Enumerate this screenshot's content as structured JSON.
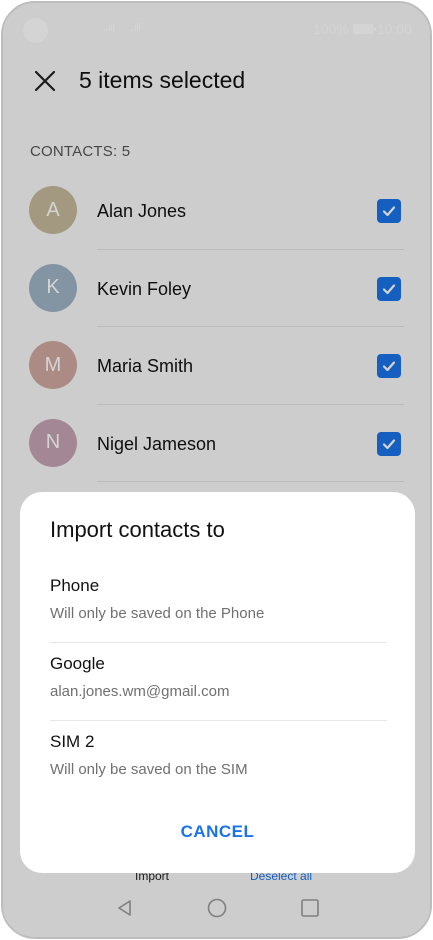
{
  "status_bar": {
    "signal_1": "..ıll",
    "signal_2": "..ıll",
    "battery": "100%",
    "time": "10:00"
  },
  "app_bar": {
    "title": "5 items selected"
  },
  "contacts_section": {
    "label": "CONTACTS: 5",
    "items": [
      {
        "initial": "A",
        "name": "Alan Jones",
        "avatar_color": "#c4b89a",
        "checked": true
      },
      {
        "initial": "K",
        "name": "Kevin Foley",
        "avatar_color": "#9eb3c4",
        "checked": true
      },
      {
        "initial": "M",
        "name": "Maria Smith",
        "avatar_color": "#cfa8a0",
        "checked": true
      },
      {
        "initial": "N",
        "name": "Nigel Jameson",
        "avatar_color": "#c4a3b2",
        "checked": true
      }
    ]
  },
  "bottom_bar": {
    "import_label": "Import",
    "deselect_label": "Deselect all"
  },
  "dialog": {
    "title": "Import contacts to",
    "options": [
      {
        "title": "Phone",
        "subtitle": "Will only be saved on the Phone"
      },
      {
        "title": "Google",
        "subtitle": "alan.jones.wm@gmail.com"
      },
      {
        "title": "SIM 2",
        "subtitle": "Will only be saved on the SIM"
      }
    ],
    "cancel_label": "CANCEL"
  },
  "colors": {
    "accent": "#1a73e8",
    "scrim": "rgba(0,0,0,0.17)"
  }
}
